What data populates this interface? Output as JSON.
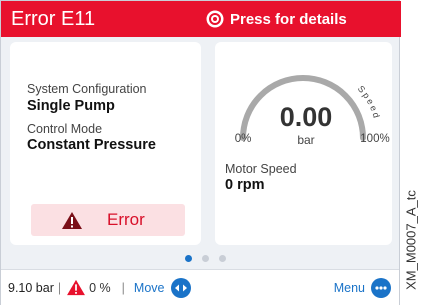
{
  "header": {
    "title": "Error E11",
    "details_label": "Press for details"
  },
  "left_card": {
    "config_label": "System Configuration",
    "config_value": "Single Pump",
    "mode_label": "Control Mode",
    "mode_value": "Constant Pressure",
    "error_button_label": "Error"
  },
  "gauge": {
    "value": "0.00",
    "unit": "bar",
    "min_label": "0%",
    "max_label": "100%",
    "arc_label": "Speed",
    "speed_percent": 0
  },
  "motor": {
    "label": "Motor Speed",
    "value": "0 rpm"
  },
  "pager": {
    "page_count": 3,
    "active_page": 1
  },
  "footer": {
    "pressure": "9.10 bar",
    "warning_percent": "0 %",
    "move_label": "Move",
    "menu_label": "Menu"
  },
  "figure_id": "XM_M0007_A_tc",
  "colors": {
    "header_red": "#e8112d",
    "accent_blue": "#1a73c8",
    "error_bg": "#fbe0e3",
    "gauge_grey": "#a9a9a9"
  }
}
